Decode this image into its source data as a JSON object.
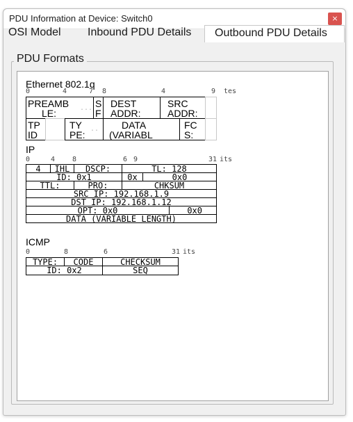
{
  "window": {
    "title": "PDU Information at Device: Switch0",
    "close_glyph": "×"
  },
  "tabs": [
    {
      "label": "OSI Model",
      "active": false
    },
    {
      "label": "Inbound PDU Details",
      "active": false
    },
    {
      "label": "Outbound PDU Details",
      "active": true
    }
  ],
  "group": {
    "label": "PDU Formats"
  },
  "ethernet": {
    "title": "Ethernet 802.1q",
    "ruler": [
      "0",
      "4",
      "7",
      "8",
      "4",
      "9",
      "tes"
    ],
    "row1": [
      {
        "text": "PREAMB",
        "text2": "LE:",
        "dim": "..."
      },
      {
        "text": "S",
        "text2": "F"
      },
      {
        "text": "DEST",
        "text2": "ADDR:"
      },
      {
        "text": "SRC",
        "text2": "ADDR:"
      }
    ],
    "row2": [
      {
        "text": "TP",
        "text2": "ID"
      },
      {
        "text": "TY",
        "text2": "PE:",
        "dim": ".."
      },
      {
        "text": "DATA",
        "text2": "(VARIABL"
      },
      {
        "text": "FC",
        "text2": "S:"
      }
    ]
  },
  "ip": {
    "title": "IP",
    "ruler": [
      "0",
      "4",
      "8",
      "6",
      "9",
      "31",
      "its"
    ],
    "rows": [
      [
        "4",
        "IHL",
        "DSCP:",
        "TL: 128"
      ],
      [
        "ID: 0x1",
        "0x",
        "0x0"
      ],
      [
        "TTL:",
        "PRO:",
        "CHKSUM"
      ],
      [
        "SRC IP: 192.168.1.9"
      ],
      [
        "DST IP: 192.168.1.12"
      ],
      [
        "OPT: 0x0",
        "0x0"
      ],
      [
        "DATA (VARIABLE LENGTH)"
      ]
    ]
  },
  "icmp": {
    "title": "ICMP",
    "ruler": [
      "0",
      "8",
      "6",
      "31",
      "its"
    ],
    "rows": [
      [
        "TYPE:",
        "CODE",
        "CHECKSUM"
      ],
      [
        "ID: 0x2",
        "SEQ"
      ]
    ]
  },
  "colors": {
    "close_bg": "#d9534f",
    "window_bg": "#f0f0f0",
    "panel_bg": "#ffffff"
  }
}
